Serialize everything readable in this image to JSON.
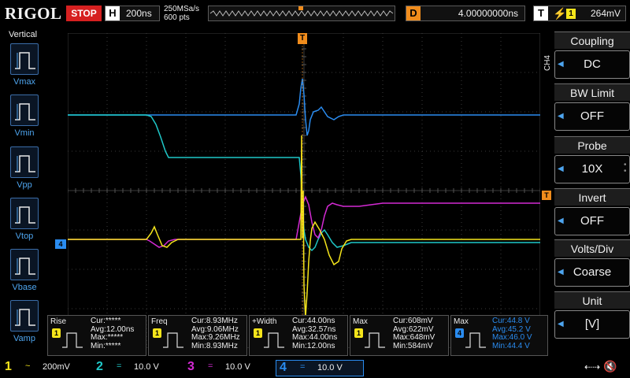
{
  "header": {
    "logo": "RIGOL",
    "run_state": "STOP",
    "horizontal_letter": "H",
    "timebase": "200ns",
    "sample_rate": "250MSa/s",
    "memory_depth": "600 pts",
    "delay_letter": "D",
    "delay": "4.00000000ns",
    "trigger_letter": "T",
    "trigger_edge": "rising-edge-icon",
    "trigger_source": "1",
    "trigger_level": "264mV"
  },
  "left_menu": {
    "title": "Vertical",
    "items": [
      {
        "label": "Vmax",
        "icon": "vmax-icon"
      },
      {
        "label": "Vmin",
        "icon": "vmin-icon"
      },
      {
        "label": "Vpp",
        "icon": "vpp-icon"
      },
      {
        "label": "Vtop",
        "icon": "vtop-icon"
      },
      {
        "label": "Vbase",
        "icon": "vbase-icon"
      },
      {
        "label": "Vamp",
        "icon": "vamp-icon"
      }
    ]
  },
  "right_menu": {
    "channel_tab": "CH4",
    "items": [
      {
        "title": "Coupling",
        "value": "DC"
      },
      {
        "title": "BW Limit",
        "value": "OFF"
      },
      {
        "title": "Probe",
        "value": "10X"
      },
      {
        "title": "Invert",
        "value": "OFF"
      },
      {
        "title": "Volts/Div",
        "value": "Coarse"
      },
      {
        "title": "Unit",
        "value": "[V]"
      }
    ]
  },
  "markers": {
    "trigger_position": "T",
    "trigger_level": "T",
    "channel4_ground": "4"
  },
  "measurements": [
    {
      "name": "Rise",
      "source": "1",
      "cur": "Cur:*****",
      "avg": "Avg:12.00ns",
      "max": "Max:*****",
      "min": "Min:*****"
    },
    {
      "name": "Freq",
      "source": "1",
      "cur": "Cur:8.93MHz",
      "avg": "Avg:9.06MHz",
      "max": "Max:9.26MHz",
      "min": "Min:8.93MHz"
    },
    {
      "name": "+Width",
      "source": "1",
      "cur": "Cur:44.00ns",
      "avg": "Avg:32.57ns",
      "max": "Max:44.00ns",
      "min": "Min:12.00ns"
    },
    {
      "name": "Max",
      "source": "1",
      "cur": "Cur:608mV",
      "avg": "Avg:622mV",
      "max": "Max:648mV",
      "min": "Min:584mV"
    },
    {
      "name": "Max",
      "source": "4",
      "cur": "Cur:44.8 V",
      "avg": "Avg:45.2 V",
      "max": "Max:46.0 V",
      "min": "Min:44.4 V"
    }
  ],
  "channels": [
    {
      "number": "1",
      "coupling": "~",
      "scale": "200mV",
      "color": "#f5e51b"
    },
    {
      "number": "2",
      "coupling": "=",
      "scale": "10.0 V",
      "color": "#1fc8c8"
    },
    {
      "number": "3",
      "coupling": "=",
      "scale": "10.0 V",
      "color": "#d42ad4"
    },
    {
      "number": "4",
      "coupling": "=",
      "scale": "10.0 V",
      "color": "#2a8cf0"
    }
  ],
  "status_icons": [
    "usb-icon",
    "speaker-mute-icon"
  ],
  "colors": {
    "ch1": "#f5e51b",
    "ch2": "#1fc8c8",
    "ch3": "#d42ad4",
    "ch4": "#2a8cf0",
    "trigger": "#f08c1c",
    "stop": "#d62020",
    "menu_accent": "#4ea5ef"
  }
}
